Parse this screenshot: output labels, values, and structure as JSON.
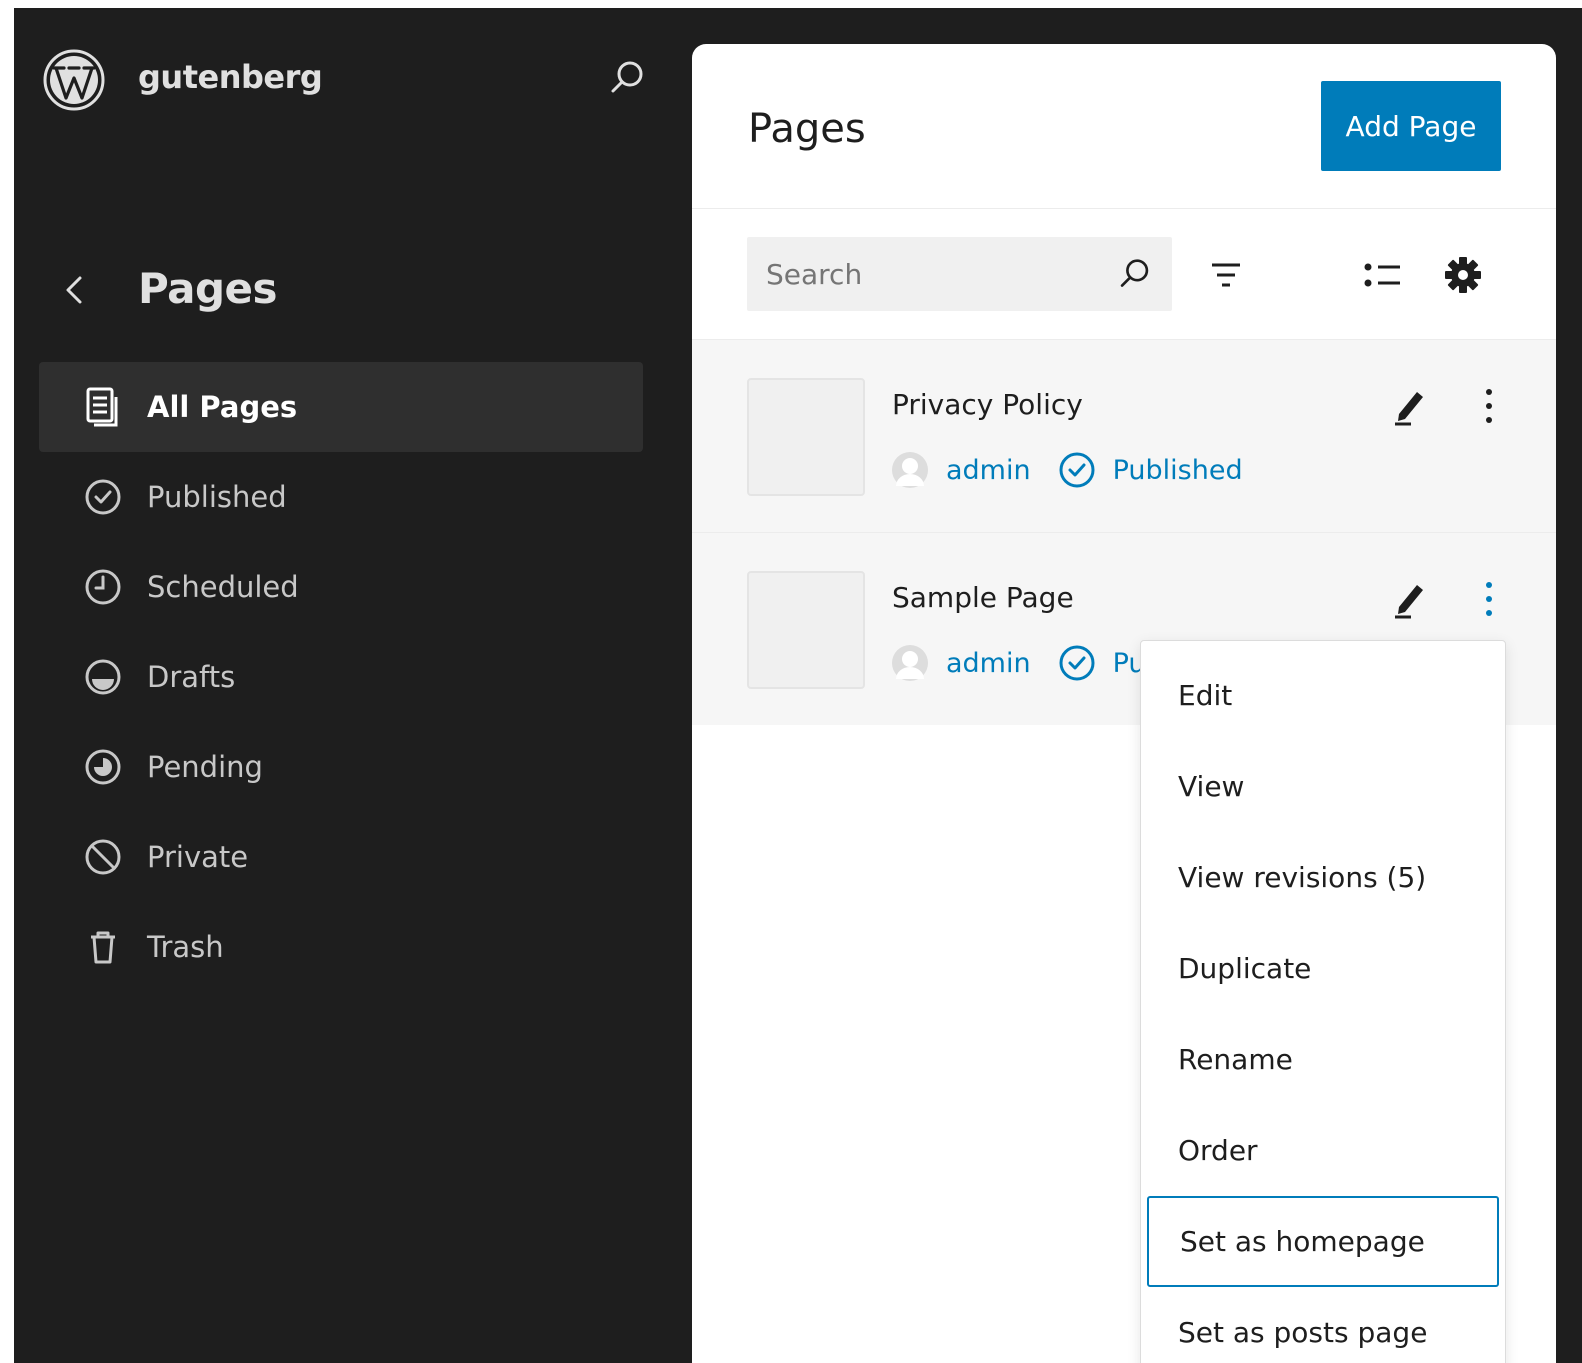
{
  "site": {
    "name": "gutenberg"
  },
  "sidebar": {
    "title": "Pages",
    "items": [
      {
        "label": "All Pages",
        "icon": "pages-icon",
        "active": true
      },
      {
        "label": "Published",
        "icon": "published-icon"
      },
      {
        "label": "Scheduled",
        "icon": "scheduled-icon"
      },
      {
        "label": "Drafts",
        "icon": "drafts-icon"
      },
      {
        "label": "Pending",
        "icon": "pending-icon"
      },
      {
        "label": "Private",
        "icon": "private-icon"
      },
      {
        "label": "Trash",
        "icon": "trash-icon"
      }
    ]
  },
  "main": {
    "title": "Pages",
    "add_button": "Add Page",
    "search_placeholder": "Search",
    "rows": [
      {
        "title": "Privacy Policy",
        "author": "admin",
        "status": "Published"
      },
      {
        "title": "Sample Page",
        "author": "admin",
        "status": "Published"
      }
    ]
  },
  "menu": {
    "items": [
      "Edit",
      "View",
      "View revisions (5)",
      "Duplicate",
      "Rename",
      "Order",
      "Set as homepage",
      "Set as posts page"
    ],
    "focused_index": 6
  },
  "colors": {
    "sidebar_bg": "#1e1e1e",
    "accent": "#007cba",
    "active_item_bg": "#2f2f2f"
  }
}
